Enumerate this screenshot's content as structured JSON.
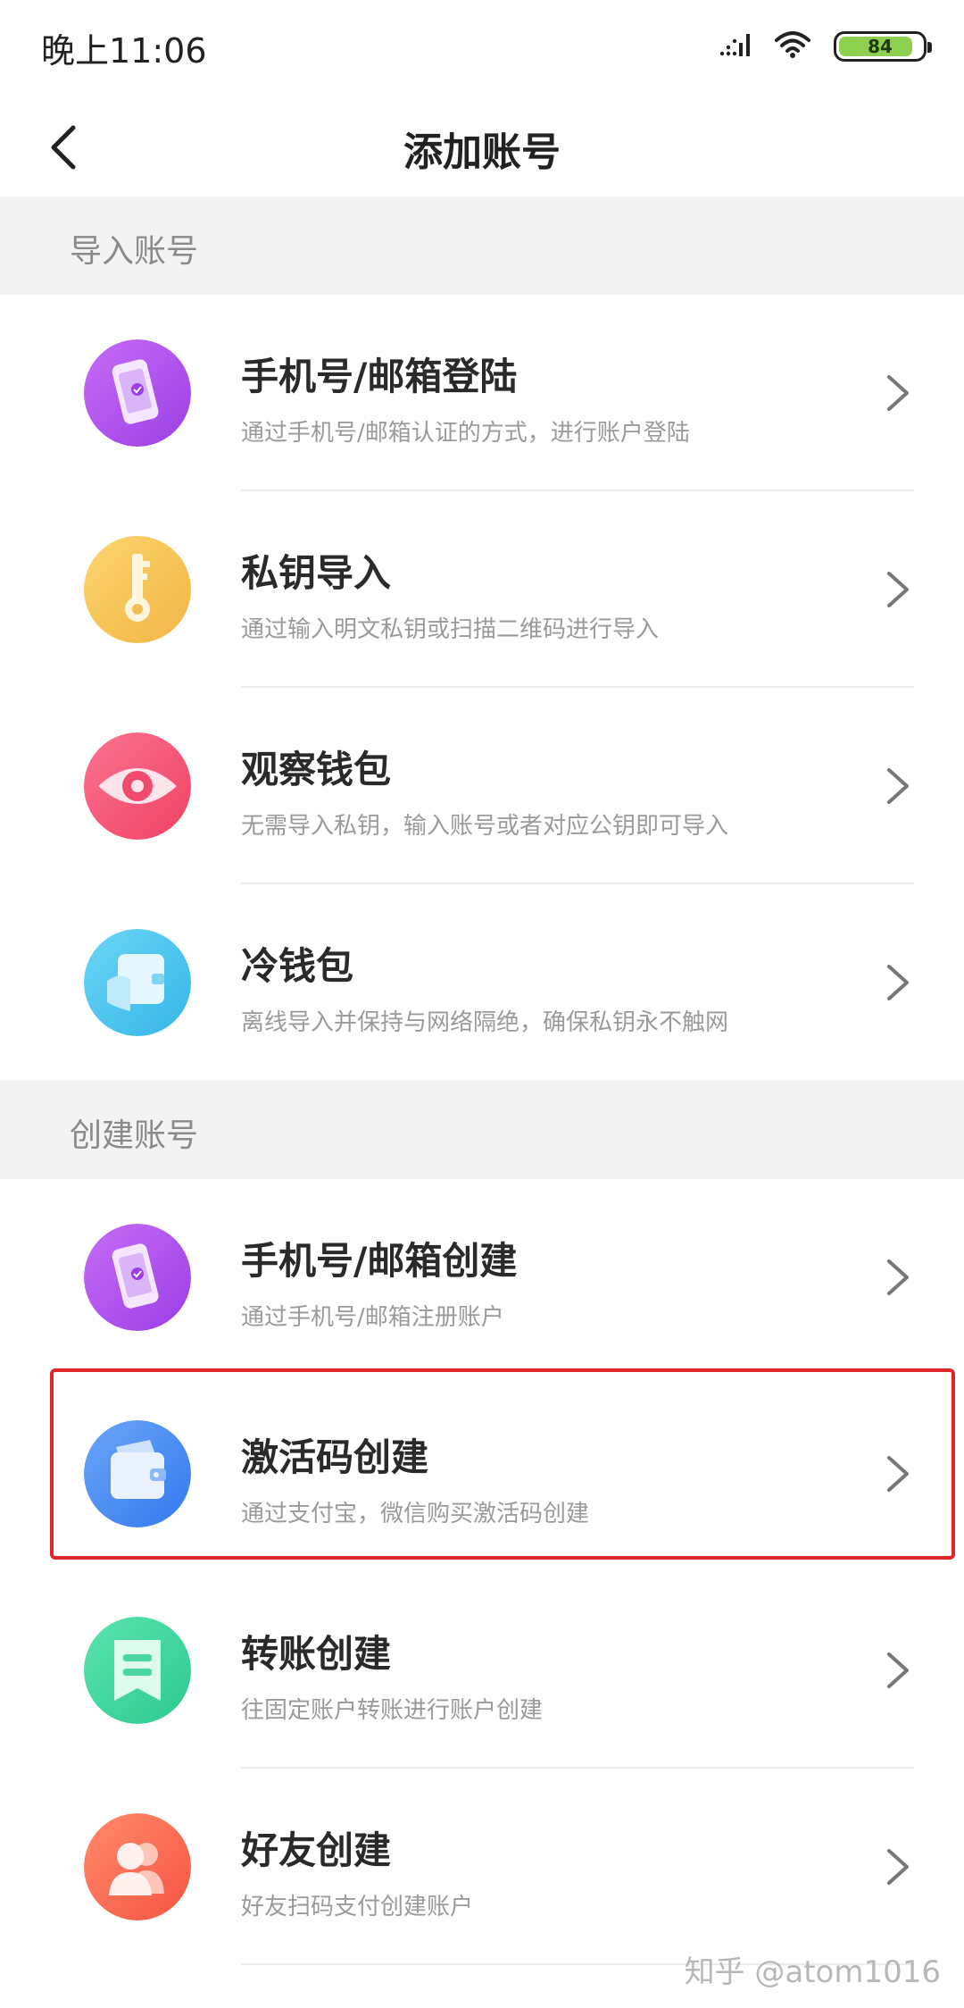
{
  "status_bar": {
    "time": "晚上11:06",
    "battery": "84"
  },
  "nav": {
    "title": "添加账号"
  },
  "sections": [
    {
      "title": "导入账号",
      "items": [
        {
          "title": "手机号/邮箱登陆",
          "desc": "通过手机号/邮箱认证的方式，进行账户登陆",
          "icon": "phone-icon",
          "color": "#b057ee"
        },
        {
          "title": "私钥导入",
          "desc": "通过输入明文私钥或扫描二维码进行导入",
          "icon": "key-icon",
          "color": "#f6c65a"
        },
        {
          "title": "观察钱包",
          "desc": "无需导入私钥，输入账号或者对应公钥即可导入",
          "icon": "eye-icon",
          "color": "#f5557a"
        },
        {
          "title": "冷钱包",
          "desc": "离线导入并保持与网络隔绝，确保私钥永不触网",
          "icon": "cold-wallet-icon",
          "color": "#4fc6ef"
        }
      ]
    },
    {
      "title": "创建账号",
      "items": [
        {
          "title": "手机号/邮箱创建",
          "desc": "通过手机号/邮箱注册账户",
          "icon": "phone-icon",
          "color": "#b057ee"
        },
        {
          "title": "激活码创建",
          "desc": "通过支付宝，微信购买激活码创建",
          "icon": "wallet-icon",
          "color": "#4a8ff3"
        },
        {
          "title": "转账创建",
          "desc": "往固定账户转账进行账户创建",
          "icon": "bookmark-icon",
          "color": "#3ed8a0"
        },
        {
          "title": "好友创建",
          "desc": "好友扫码支付创建账户",
          "icon": "friends-icon",
          "color": "#fb6a54"
        }
      ]
    }
  ],
  "watermark": "知乎 @atom1016",
  "highlight_color": "#e0262a"
}
